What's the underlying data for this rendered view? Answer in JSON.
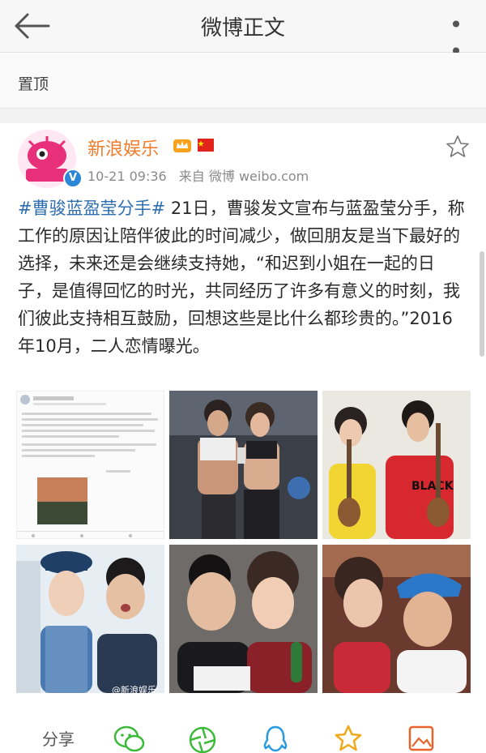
{
  "header": {
    "title": "微博正文",
    "more_label": "• • •"
  },
  "pin": {
    "label": "置顶"
  },
  "post": {
    "author": "新浪娱乐",
    "avatar_text": "新浪娱乐",
    "date": "10-21 09:36",
    "source": "来自 微博 weibo.com",
    "topic": "#曹骏蓝盈莹分手#",
    "text": " 21日，曹骏发文宣布与蓝盈莹分手，称工作的原因让陪伴彼此的时间减少，做回朋友是当下最好的选择，未来还是会继续支持她，“和迟到小姐在一起的日子，是值得回忆的时光，共同经历了许多有意义的时刻，我们彼此支持相互鼓励，回想这些是比什么都珍贵的。”2016年10月，二人恋情曝光。",
    "watermark": "@新浪娱乐"
  },
  "actions": {
    "share_label": "分享"
  },
  "colors": {
    "accent": "#f07c2c",
    "link": "#2f6fb1",
    "verified": "#2b87d6"
  }
}
